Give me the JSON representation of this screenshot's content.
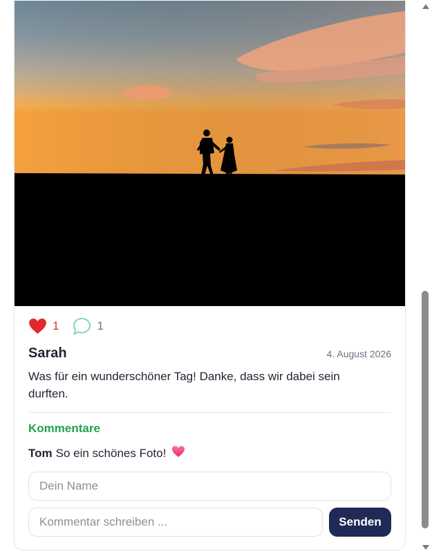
{
  "post": {
    "likes": "1",
    "comments_count": "1",
    "author": "Sarah",
    "date": "4. August 2026",
    "text": "Was für ein wunderschöner Tag! Danke, dass wir dabei sein durften."
  },
  "comments_section": {
    "title": "Kommentare",
    "items": [
      {
        "author": "Tom",
        "text": "So ein schönes Foto!"
      }
    ]
  },
  "form": {
    "name_placeholder": "Dein Name",
    "comment_placeholder": "Kommentar schreiben ...",
    "send_label": "Senden"
  },
  "colors": {
    "like": "#e0282e",
    "comment_icon": "#7fd3c7",
    "accent_green": "#21a24b",
    "button": "#1f2a56"
  }
}
